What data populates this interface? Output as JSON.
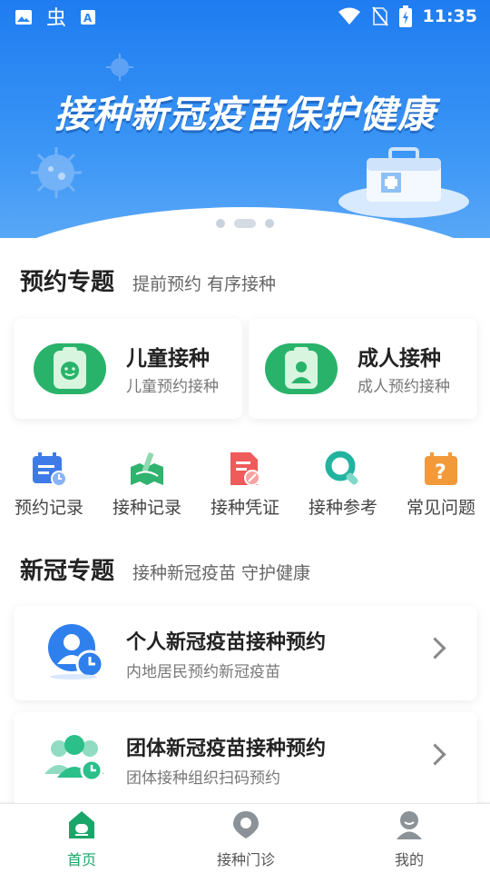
{
  "status_bar": {
    "time": "11:35",
    "left_icons": [
      "image-icon",
      "bug-icon",
      "font-icon"
    ],
    "right_icons": [
      "wifi-icon",
      "no-sim-icon",
      "battery-charging-icon"
    ]
  },
  "banner": {
    "title": "接种新冠疫苗保护健康",
    "pages": 3,
    "active_page": 2
  },
  "appointment": {
    "title": "预约专题",
    "subtitle": "提前预约 有序接种",
    "cards": [
      {
        "title": "儿童接种",
        "subtitle": "儿童预约接种",
        "icon": "child-icon"
      },
      {
        "title": "成人接种",
        "subtitle": "成人预约接种",
        "icon": "adult-icon"
      }
    ]
  },
  "quick_links": [
    {
      "label": "预约记录",
      "icon": "calendar-clock-icon",
      "color": "#3f7be8"
    },
    {
      "label": "接种记录",
      "icon": "vaccine-record-icon",
      "color": "#2fb36e"
    },
    {
      "label": "接种凭证",
      "icon": "certificate-icon",
      "color": "#ef5a5a"
    },
    {
      "label": "接种参考",
      "icon": "search-reference-icon",
      "color": "#22b3a0"
    },
    {
      "label": "常见问题",
      "icon": "question-icon",
      "color": "#f29a3a"
    }
  ],
  "covid": {
    "title": "新冠专题",
    "subtitle": "接种新冠疫苗 守护健康",
    "items": [
      {
        "title": "个人新冠疫苗接种预约",
        "subtitle": "内地居民预约新冠疫苗",
        "icon": "person-clock-icon"
      },
      {
        "title": "团体新冠疫苗接种预约",
        "subtitle": "团体接种组织扫码预约",
        "icon": "group-clock-icon"
      }
    ]
  },
  "tab_bar": {
    "active": 0,
    "tabs": [
      {
        "label": "首页",
        "icon": "home-icon"
      },
      {
        "label": "接种门诊",
        "icon": "clinic-location-icon"
      },
      {
        "label": "我的",
        "icon": "profile-icon"
      }
    ]
  },
  "colors": {
    "banner_blue": "#2a86f2",
    "accent_green": "#1aa569"
  }
}
